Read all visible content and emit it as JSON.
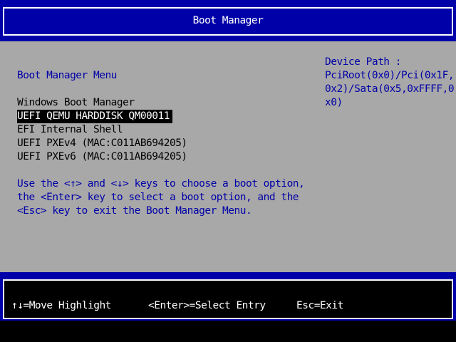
{
  "header": {
    "title": "Boot Manager"
  },
  "menu": {
    "title": "Boot Manager Menu",
    "selected_index": 1,
    "entries": [
      "Windows Boot Manager",
      "UEFI QEMU HARDDISK QM00011",
      "EFI Internal Shell",
      "UEFI PXEv4 (MAC:C011AB694205)",
      "UEFI PXEv6 (MAC:C011AB694205)"
    ]
  },
  "help_text": [
    "Use the <↑> and <↓> keys to choose a boot option,",
    "the <Enter> key to select a boot option, and the",
    "<Esc> key to exit the Boot Manager Menu."
  ],
  "device_path": {
    "label": "Device Path :",
    "lines": [
      "PciRoot(0x0)/Pci(0x1F,",
      "0x2)/Sata(0x5,0xFFFF,0",
      "x0)"
    ]
  },
  "footer": {
    "items": [
      "↑↓=Move Highlight",
      "<Enter>=Select Entry",
      "Esc=Exit"
    ]
  },
  "colors": {
    "background": "#a8a8a8",
    "band": "#0000a8",
    "highlight_bg": "#000000",
    "highlight_fg": "#ffffff",
    "text": "#000000",
    "accent_text": "#0000a8"
  }
}
